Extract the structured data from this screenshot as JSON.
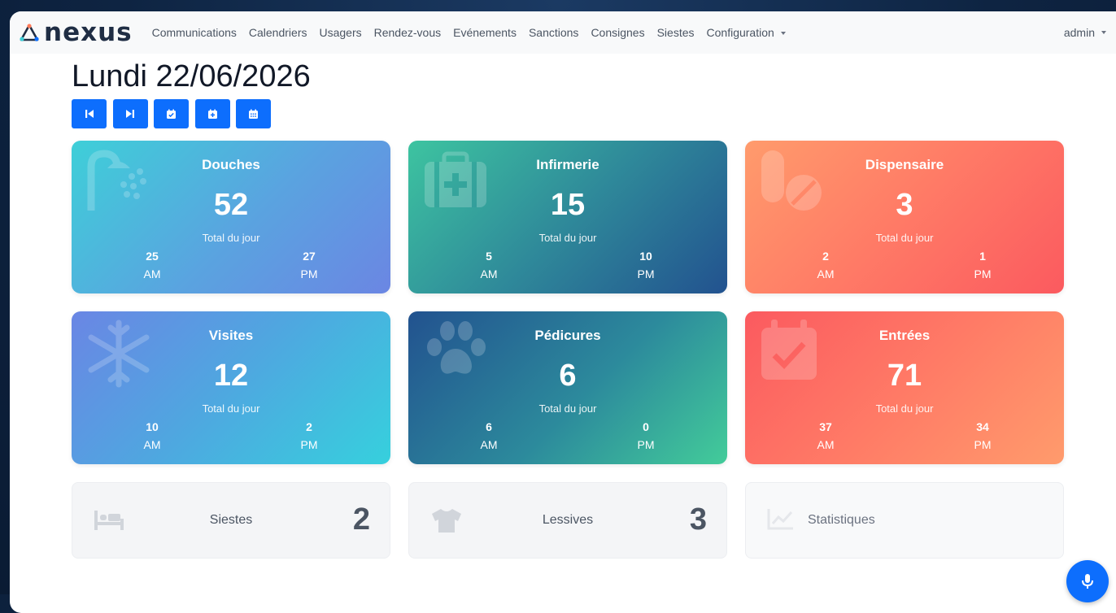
{
  "brand": {
    "name": "nexus"
  },
  "nav": {
    "items": [
      "Communications",
      "Calendriers",
      "Usagers",
      "Rendez-vous",
      "Evénements",
      "Sanctions",
      "Consignes",
      "Siestes",
      "Configuration"
    ],
    "user": "admin"
  },
  "page": {
    "title": "Lundi 22/06/2026"
  },
  "date_buttons": [
    "previous-day-icon",
    "next-day-icon",
    "calendar-check-icon",
    "calendar-plus-icon",
    "calendar-grid-icon"
  ],
  "cards": [
    {
      "title": "Douches",
      "total": "52",
      "subtitle": "Total du jour",
      "am_value": "25",
      "am_label": "AM",
      "pm_value": "27",
      "pm_label": "PM",
      "icon": "shower-icon"
    },
    {
      "title": "Infirmerie",
      "total": "15",
      "subtitle": "Total du jour",
      "am_value": "5",
      "am_label": "AM",
      "pm_value": "10",
      "pm_label": "PM",
      "icon": "medkit-icon"
    },
    {
      "title": "Dispensaire",
      "total": "3",
      "subtitle": "Total du jour",
      "am_value": "2",
      "am_label": "AM",
      "pm_value": "1",
      "pm_label": "PM",
      "icon": "pills-icon"
    },
    {
      "title": "Visites",
      "total": "12",
      "subtitle": "Total du jour",
      "am_value": "10",
      "am_label": "AM",
      "pm_value": "2",
      "pm_label": "PM",
      "icon": "snowflake-icon"
    },
    {
      "title": "Pédicures",
      "total": "6",
      "subtitle": "Total du jour",
      "am_value": "6",
      "am_label": "AM",
      "pm_value": "0",
      "pm_label": "PM",
      "icon": "paw-icon"
    },
    {
      "title": "Entrées",
      "total": "71",
      "subtitle": "Total du jour",
      "am_value": "37",
      "am_label": "AM",
      "pm_value": "34",
      "pm_label": "PM",
      "icon": "calendar-check-icon"
    }
  ],
  "small_cards": [
    {
      "label": "Siestes",
      "value": "2",
      "icon": "bed-icon"
    },
    {
      "label": "Lessives",
      "value": "3",
      "icon": "shirt-icon"
    },
    {
      "label": "Statistiques",
      "icon": "chart-line-icon"
    }
  ],
  "colors": {
    "primary": "#0d6efd",
    "navbar_bg": "#f8f9fa"
  }
}
